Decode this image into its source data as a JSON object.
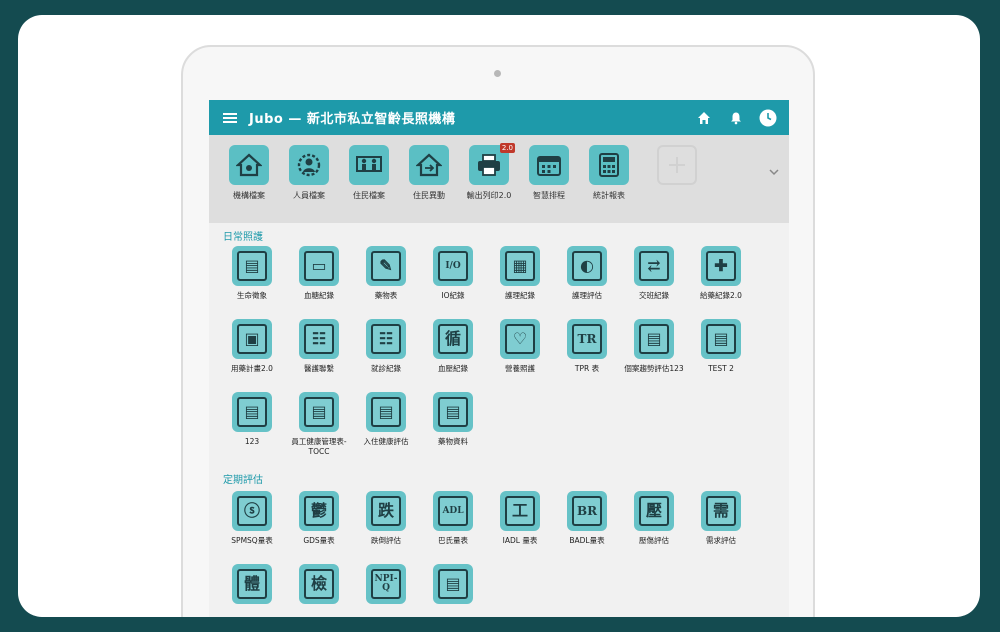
{
  "app": {
    "title": "Jubo — 新北市私立智齡長照機構"
  },
  "quickbar": [
    {
      "label": "機構檔案",
      "icon": "house-icon"
    },
    {
      "label": "人員檔案",
      "icon": "staff-icon"
    },
    {
      "label": "住民檔案",
      "icon": "residents-icon"
    },
    {
      "label": "住民異動",
      "icon": "house-exchange-icon"
    },
    {
      "label": "輸出列印2.0",
      "icon": "printer-icon",
      "badge": "2.0"
    },
    {
      "label": "智慧排程",
      "icon": "calendar-icon"
    },
    {
      "label": "統計報表",
      "icon": "calculator-icon"
    }
  ],
  "sections": {
    "daily": {
      "title": "日常照護",
      "items": [
        {
          "label": "生命徵象",
          "glyph": "▤"
        },
        {
          "label": "血糖紀錄",
          "glyph": "▭"
        },
        {
          "label": "藥物表",
          "glyph": "✎"
        },
        {
          "label": "IO紀錄",
          "glyph": "I/O"
        },
        {
          "label": "護理紀錄",
          "glyph": "▦"
        },
        {
          "label": "護理評估",
          "glyph": "◐"
        },
        {
          "label": "交班紀錄",
          "glyph": "⇄"
        },
        {
          "label": "給藥紀錄2.0",
          "glyph": "✚"
        },
        {
          "label": "用藥計畫2.0",
          "glyph": "▣"
        },
        {
          "label": "醫護聯繫",
          "glyph": "☷"
        },
        {
          "label": "就診紀錄",
          "glyph": "☷"
        },
        {
          "label": "血壓紀錄",
          "glyph": "循"
        },
        {
          "label": "營養照護",
          "glyph": "♡"
        },
        {
          "label": "TPR 表",
          "glyph": "TR"
        },
        {
          "label": "個案趨勢評估123",
          "glyph": "▤"
        },
        {
          "label": "TEST 2",
          "glyph": "▤"
        },
        {
          "label": "123",
          "glyph": "▤"
        },
        {
          "label": "員工健康管理表-TOCC",
          "glyph": "▤"
        },
        {
          "label": "入住健康評估",
          "glyph": "▤"
        },
        {
          "label": "藥物資料",
          "glyph": "▤"
        }
      ]
    },
    "periodic": {
      "title": "定期評估",
      "items": [
        {
          "label": "SPMSQ量表",
          "glyph": "ⓢ"
        },
        {
          "label": "GDS量表",
          "glyph": "鬱"
        },
        {
          "label": "跌倒評估",
          "glyph": "跌"
        },
        {
          "label": "巴氏量表",
          "glyph": "ADL"
        },
        {
          "label": "IADL 量表",
          "glyph": "工"
        },
        {
          "label": "BADL量表",
          "glyph": "BR"
        },
        {
          "label": "壓傷評估",
          "glyph": "壓"
        },
        {
          "label": "需求評估",
          "glyph": "需"
        },
        {
          "label": "",
          "glyph": "體"
        },
        {
          "label": "",
          "glyph": "檢"
        },
        {
          "label": "",
          "glyph": "NPI-Q"
        },
        {
          "label": "",
          "glyph": "▤"
        }
      ]
    }
  }
}
